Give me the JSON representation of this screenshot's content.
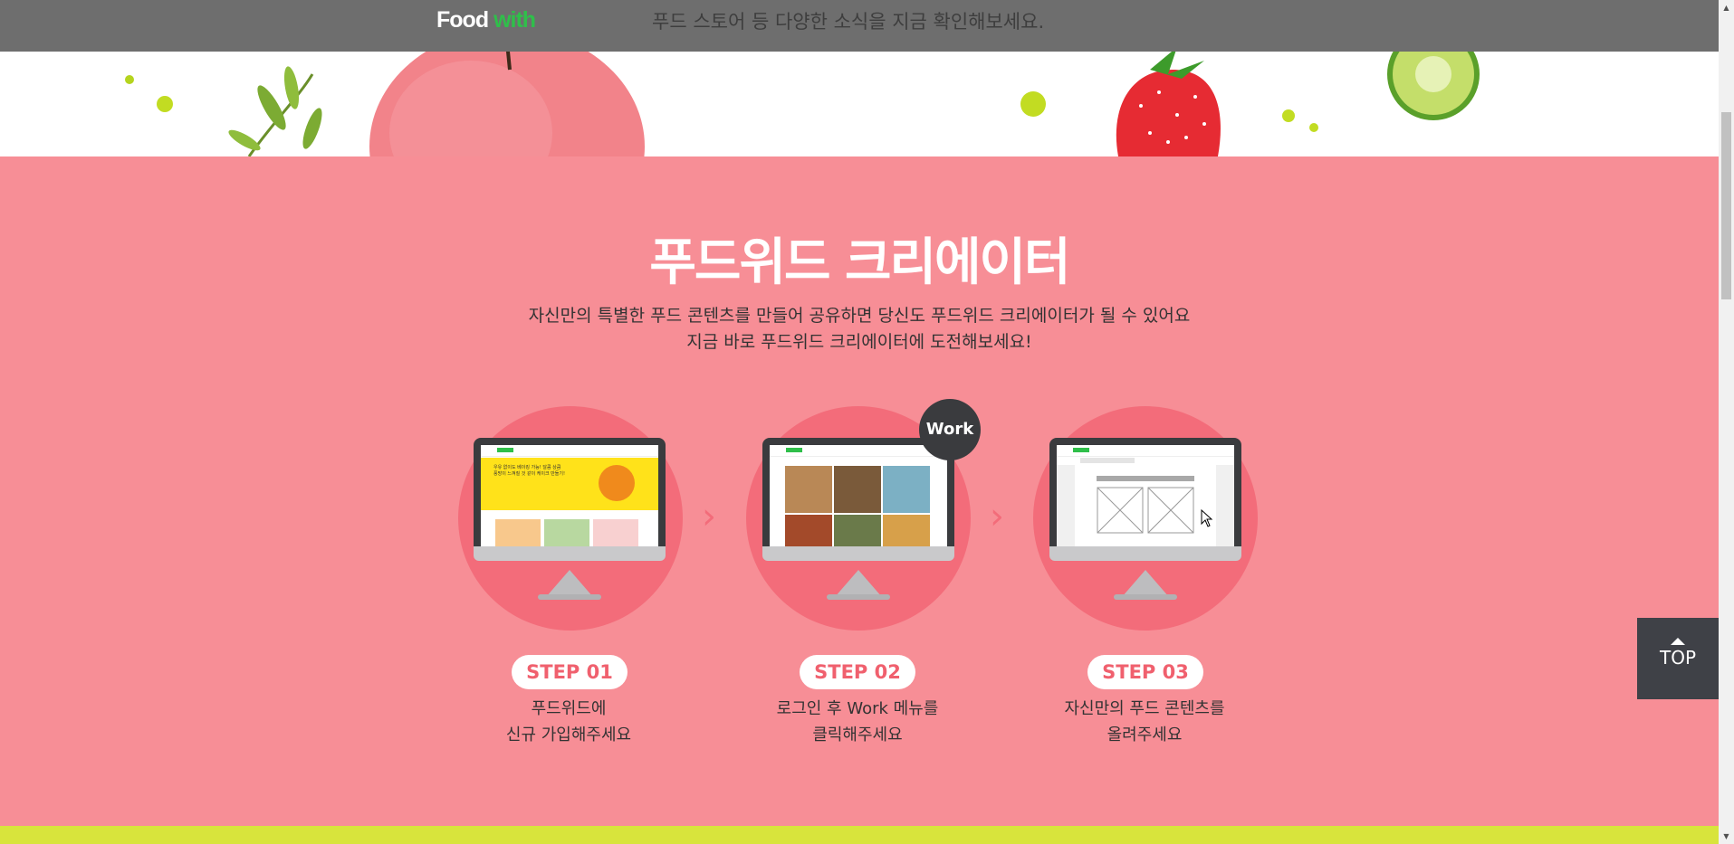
{
  "header": {
    "logo_food": "Food",
    "logo_with": "with",
    "notice_text": "푸드 스토어 등 다양한 소식을 지금 확인해보세요."
  },
  "creator": {
    "title": "푸드위드 크리에이터",
    "subtitle_line1": "자신만의 특별한 푸드 콘텐츠를 만들어 공유하면 당신도 푸드위드 크리에이터가 될 수 있어요",
    "subtitle_line2": "지금 바로 푸드위드 크리에이터에 도전해보세요!",
    "work_badge": "Work",
    "steps": [
      {
        "label": "STEP 01",
        "desc_line1": "푸드위드에",
        "desc_line2": "신규 가입해주세요"
      },
      {
        "label": "STEP 02",
        "desc_line1": "로그인 후 Work 메뉴를",
        "desc_line2": "클릭해주세요"
      },
      {
        "label": "STEP 03",
        "desc_line1": "자신만의 푸드 콘텐츠를",
        "desc_line2": "올려주세요"
      }
    ],
    "screen1_text": "우유 없이도 베이킹 가능! 달콤 상큼 풍망이 느껴질 것 같이 케이크 만들기!"
  },
  "top_button": {
    "label": "TOP"
  },
  "colors": {
    "pink_bg": "#f78e96",
    "circle": "#f36c7a",
    "header_bg": "#6e6e6e",
    "accent_green": "#2fbf4a",
    "yellow_strip": "#d8e43c"
  },
  "icons": [
    "arrow-right-icon",
    "arrow-up-icon",
    "cursor-icon",
    "peach-icon",
    "strawberry-icon",
    "cucumber-icon",
    "leaf-icon"
  ]
}
